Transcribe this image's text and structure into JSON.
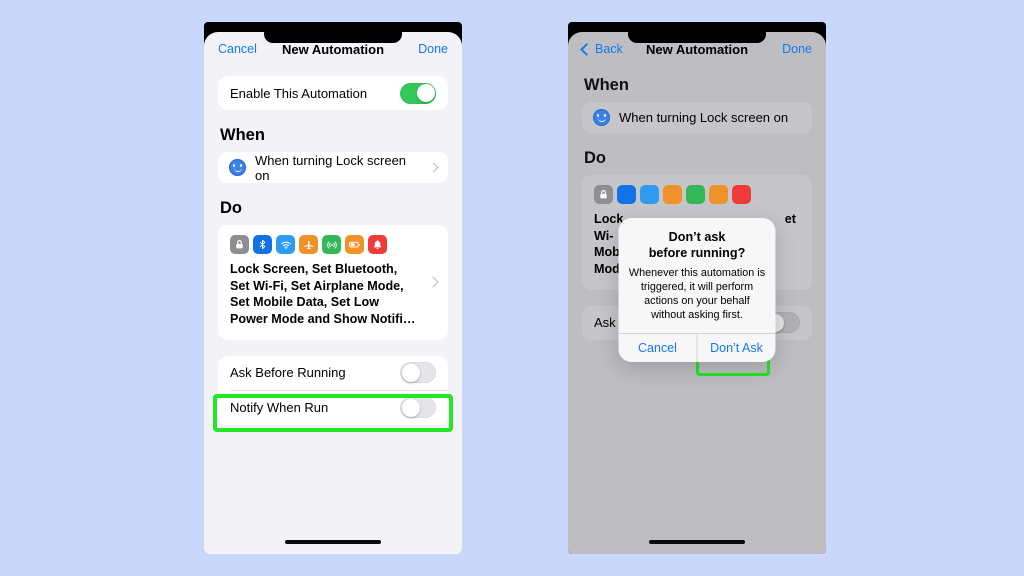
{
  "background_color": "#c9d7fa",
  "accent_color": "#1578f2",
  "highlight_color": "#22e626",
  "left_phone": {
    "name": "new-automation-screen",
    "navbar": {
      "left_label": "Cancel",
      "title": "New Automation",
      "right_label": "Done"
    },
    "enable_row": {
      "label": "Enable This Automation",
      "toggle_state": "on"
    },
    "when": {
      "heading": "When",
      "trigger_label": "When turning Lock screen on",
      "trigger_icon": "smiley-face-icon",
      "disclosure_icon": "chevron-right-icon"
    },
    "do": {
      "heading": "Do",
      "action_icons": [
        {
          "name": "lock-screen-icon",
          "color": "#8e8e93",
          "glyph": "lock"
        },
        {
          "name": "bluetooth-icon",
          "color": "#1273e6",
          "glyph": "bluetooth"
        },
        {
          "name": "wifi-icon",
          "color": "#2f9bf0",
          "glyph": "wifi"
        },
        {
          "name": "airplane-mode-icon",
          "color": "#f0922a",
          "glyph": "airplane"
        },
        {
          "name": "mobile-data-icon",
          "color": "#34b759",
          "glyph": "cellular"
        },
        {
          "name": "low-power-mode-icon",
          "color": "#f0922a",
          "glyph": "battery"
        },
        {
          "name": "show-notification-icon",
          "color": "#ef3b39",
          "glyph": "bell"
        }
      ],
      "summary": "Lock Screen, Set Bluetooth, Set Wi-Fi, Set Airplane Mode, Set Mobile Data, Set Low Power Mode and Show Notifi…",
      "disclosure_icon": "chevron-right-icon"
    },
    "options": [
      {
        "label": "Ask Before Running",
        "toggle_state": "off",
        "highlighted": true
      },
      {
        "label": "Notify When Run",
        "toggle_state": "off",
        "highlighted": false
      }
    ]
  },
  "right_phone": {
    "name": "new-automation-screen-with-alert",
    "navbar": {
      "left_label": "Back",
      "back_icon": "chevron-left-icon",
      "title": "New Automation",
      "right_label": "Done"
    },
    "when": {
      "heading": "When",
      "trigger_label": "When turning Lock screen on",
      "trigger_icon": "smiley-face-icon"
    },
    "do": {
      "heading": "Do",
      "action_icons": [
        {
          "name": "lock-screen-icon",
          "color": "#8e8e93",
          "glyph": "lock"
        },
        {
          "name": "bluetooth-icon",
          "color": "#1273e6",
          "glyph": "bluetooth"
        },
        {
          "name": "wifi-icon",
          "color": "#2f9bf0",
          "glyph": "wifi"
        },
        {
          "name": "airplane-mode-icon",
          "color": "#f0922a",
          "glyph": "airplane"
        },
        {
          "name": "mobile-data-icon",
          "color": "#34b759",
          "glyph": "cellular"
        },
        {
          "name": "low-power-mode-icon",
          "color": "#f0922a",
          "glyph": "battery"
        },
        {
          "name": "show-notification-icon",
          "color": "#ef3b39",
          "glyph": "bell"
        }
      ],
      "summary_line1": "Lock",
      "summary_line2": "Wi-",
      "summary_line3": "Mob",
      "summary_line4": "Mod",
      "summary_right": "et"
    },
    "options": [
      {
        "label": "Ask",
        "toggle_state": "off"
      }
    ],
    "alert": {
      "title_line1": "Don’t ask",
      "title_line2": "before running?",
      "message": "Whenever this automation is triggered, it will perform actions on your behalf without asking first.",
      "cancel_label": "Cancel",
      "confirm_label": "Don’t Ask",
      "confirm_highlighted": true
    }
  }
}
